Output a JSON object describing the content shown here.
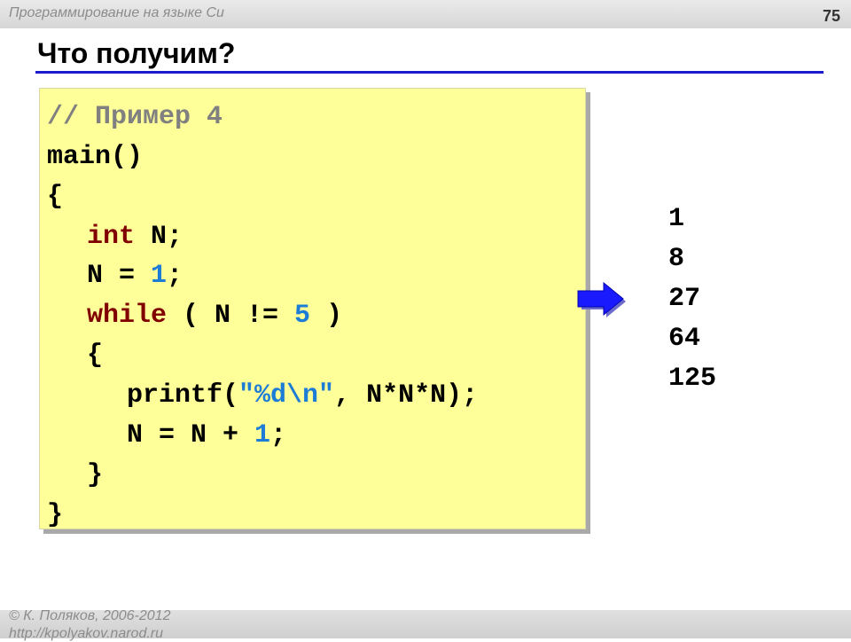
{
  "header": {
    "course": "Программирование на языке Си",
    "page_number": "75"
  },
  "slide": {
    "title": "Что получим?"
  },
  "code": {
    "comment": "// Пример 4",
    "main_sig": "main()",
    "open_brace": "{",
    "decl_kw": "int",
    "decl_rest": " N;",
    "assign_lhs": "N = ",
    "assign_num": "1",
    "assign_end": ";",
    "while_kw": "while",
    "while_mid": " ( N != ",
    "while_num": "5",
    "while_end": " )",
    "inner_open": "{",
    "printf_start": "printf(",
    "printf_str": "\"%d\\n\"",
    "printf_end": ", N*N*N);",
    "incr_lhs": "N = N + ",
    "incr_num": "1",
    "incr_end": ";",
    "inner_close": "}",
    "close_brace": "}"
  },
  "output": [
    "1",
    "8",
    "27",
    "64",
    "125"
  ],
  "footer": {
    "copyright": "© К. Поляков, 2006-2012",
    "url": "http://kpolyakov.narod.ru"
  },
  "colors": {
    "title_rule": "#1c1ccc",
    "code_background": "#ffff99",
    "keyword": "#800000",
    "number": "#1c7cd6",
    "comment": "#808080",
    "arrow": "#1a1aff"
  },
  "icons": {
    "arrow": "right-arrow-icon"
  }
}
